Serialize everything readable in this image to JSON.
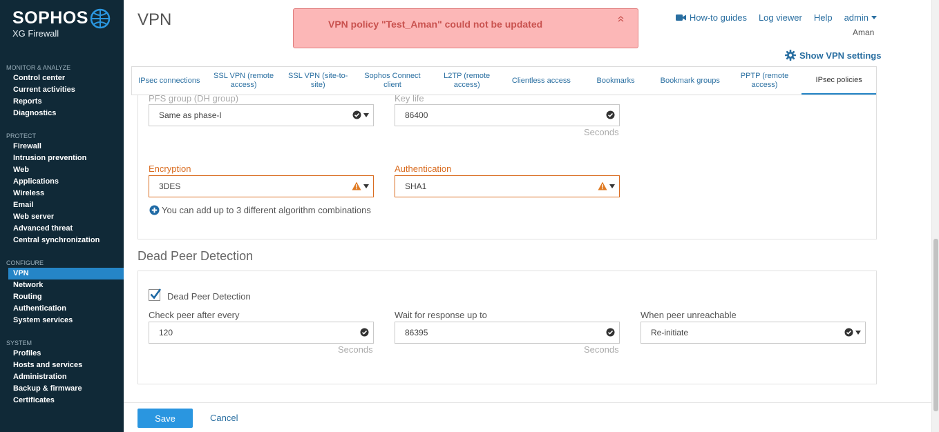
{
  "brand": {
    "name": "SOPHOS",
    "product": "XG Firewall"
  },
  "sidebar": {
    "sections": [
      {
        "heading": "MONITOR & ANALYZE",
        "items": [
          "Control center",
          "Current activities",
          "Reports",
          "Diagnostics"
        ]
      },
      {
        "heading": "PROTECT",
        "items": [
          "Firewall",
          "Intrusion prevention",
          "Web",
          "Applications",
          "Wireless",
          "Email",
          "Web server",
          "Advanced threat",
          "Central synchronization"
        ]
      },
      {
        "heading": "CONFIGURE",
        "items": [
          "VPN",
          "Network",
          "Routing",
          "Authentication",
          "System services"
        ]
      },
      {
        "heading": "SYSTEM",
        "items": [
          "Profiles",
          "Hosts and services",
          "Administration",
          "Backup & firmware",
          "Certificates"
        ]
      }
    ],
    "active": "VPN"
  },
  "header": {
    "title": "VPN",
    "alert": "VPN policy \"Test_Aman\" could not be updated",
    "links": {
      "howto": "How-to guides",
      "log": "Log viewer",
      "help": "Help",
      "admin": "admin"
    },
    "username": "Aman",
    "show_settings": "Show VPN settings"
  },
  "tabs": [
    "IPsec connections",
    "SSL VPN (remote access)",
    "SSL VPN (site-to-site)",
    "Sophos Connect client",
    "L2TP (remote access)",
    "Clientless access",
    "Bookmarks",
    "Bookmark groups",
    "PPTP (remote access)",
    "IPsec policies"
  ],
  "active_tab": "IPsec policies",
  "phase2": {
    "pfs_label": "PFS group (DH group)",
    "pfs_value": "Same as phase-I",
    "keylife_label": "Key life",
    "keylife_value": "86400",
    "keylife_unit": "Seconds",
    "encryption_label": "Encryption",
    "encryption_value": "3DES",
    "auth_label": "Authentication",
    "auth_value": "SHA1",
    "add_combo": "You can add up to 3 different algorithm combinations"
  },
  "dpd": {
    "section_title": "Dead Peer Detection",
    "checkbox_label": "Dead Peer Detection",
    "checked": true,
    "check_label": "Check peer after every",
    "check_value": "120",
    "check_unit": "Seconds",
    "wait_label": "Wait for response up to",
    "wait_value": "86395",
    "wait_unit": "Seconds",
    "unreachable_label": "When peer unreachable",
    "unreachable_value": "Re-initiate"
  },
  "footer": {
    "save": "Save",
    "cancel": "Cancel"
  },
  "colors": {
    "sidebar": "#102937",
    "accent": "#2585c7",
    "warning": "#d96b1f",
    "alert_bg": "#fcb7b7"
  }
}
